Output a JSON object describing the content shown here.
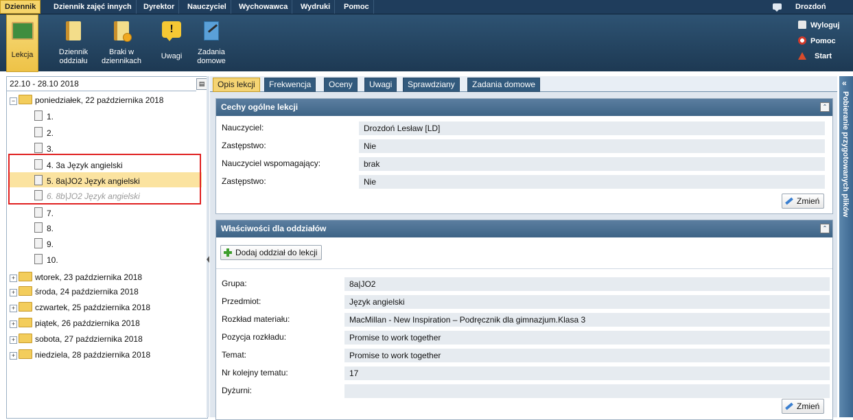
{
  "menu": {
    "items": [
      "Dziennik",
      "Dziennik zajęć innych",
      "Dyrektor",
      "Nauczyciel",
      "Wychowawca",
      "Wydruki",
      "Pomoc"
    ],
    "user": "Drozdoń Lesław"
  },
  "toolbar": {
    "buttons": [
      "Lekcja",
      "Dziennik\noddziału",
      "Braki w\ndziennikach",
      "Uwagi",
      "Zadania\ndomowe"
    ],
    "right_links": [
      "Wyloguj",
      "Pomoc",
      "Start"
    ]
  },
  "left": {
    "week": "22.10 - 28.10 2018",
    "days": [
      "poniedziałek, 22 października 2018",
      "wtorek, 23 października 2018",
      "środa, 24 października 2018",
      "czwartek, 25 października 2018",
      "piątek, 26 października 2018",
      "sobota, 27 października 2018",
      "niedziela, 28 października 2018"
    ],
    "lessons": [
      "1.",
      "2.",
      "3.",
      "4. 3a Język angielski",
      "5. 8a|JO2 Język angielski",
      "6. 8b|JO2 Język angielski",
      "7.",
      "8.",
      "9.",
      "10."
    ]
  },
  "tabs": [
    "Opis lekcji",
    "Frekwencja",
    "Oceny",
    "Uwagi",
    "Sprawdziany",
    "Zadania domowe"
  ],
  "general": {
    "title": "Cechy ogólne lekcji",
    "rows": [
      {
        "label": "Nauczyciel:",
        "value": "Drozdoń Lesław [LD]"
      },
      {
        "label": "Zastępstwo:",
        "value": "Nie"
      },
      {
        "label": "Nauczyciel wspomagający:",
        "value": "brak"
      },
      {
        "label": "Zastępstwo:",
        "value": "Nie"
      }
    ],
    "change": "Zmień"
  },
  "classes": {
    "title": "Właściwości dla oddziałów",
    "add": "Dodaj oddział do lekcji",
    "rows": [
      {
        "label": "Grupa:",
        "value": "8a|JO2"
      },
      {
        "label": "Przedmiot:",
        "value": "Język angielski"
      },
      {
        "label": "Rozkład materiału:",
        "value": "MacMillan - New Inspiration – Podręcznik dla gimnazjum.Klasa 3"
      },
      {
        "label": "Pozycja rozkładu:",
        "value": "Promise to work together"
      },
      {
        "label": "Temat:",
        "value": "Promise to work together"
      },
      {
        "label": "Nr kolejny tematu:",
        "value": "17"
      },
      {
        "label": "Dyżurni:",
        "value": ""
      }
    ],
    "change": "Zmień"
  },
  "side_panel": "Pobieranie przygotowanych plików"
}
